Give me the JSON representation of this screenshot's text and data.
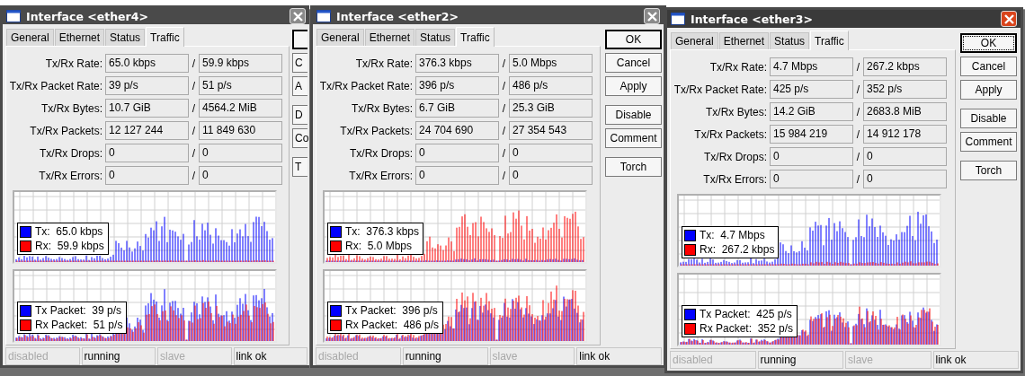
{
  "windows": [
    {
      "title": "Interface <ether4>",
      "active": false,
      "tabs": [
        {
          "label": "General",
          "selected": false
        },
        {
          "label": "Ethernet",
          "selected": false
        },
        {
          "label": "Status",
          "selected": false
        },
        {
          "label": "Traffic",
          "selected": true
        }
      ],
      "fields": [
        {
          "label": "Tx/Rx Rate:",
          "tx": "65.0 kbps",
          "separator": "/",
          "rx": "59.9 kbps"
        },
        {
          "label": "Tx/Rx Packet Rate:",
          "tx": "39 p/s",
          "separator": "/",
          "rx": "51 p/s"
        },
        {
          "label": "Tx/Rx Bytes:",
          "tx": "10.7 GiB",
          "separator": "/",
          "rx": "4564.2 MiB"
        },
        {
          "label": "Tx/Rx Packets:",
          "tx": "12 127 244",
          "separator": "/",
          "rx": "11 849 630"
        },
        {
          "label": "Tx/Rx Drops:",
          "tx": "0",
          "separator": "/",
          "rx": "0"
        },
        {
          "label": "Tx/Rx Errors:",
          "tx": "0",
          "separator": "/",
          "rx": "0"
        }
      ],
      "graphs": [
        {
          "legend": [
            {
              "label": "Tx:",
              "value": "65.0 kbps",
              "color": "#0000ff"
            },
            {
              "label": "Rx:",
              "value": "59.9 kbps",
              "color": "#ff0000"
            }
          ]
        },
        {
          "legend": [
            {
              "label": "Tx Packet:",
              "value": "39 p/s",
              "color": "#0000ff"
            },
            {
              "label": "Rx Packet:",
              "value": "51 p/s",
              "color": "#ff0000"
            }
          ]
        }
      ],
      "buttons": [
        {
          "default": true,
          "focused": false
        },
        {
          "label": "C",
          "default": false,
          "focused": false
        },
        {
          "label": "A",
          "default": false,
          "focused": false
        },
        {
          "label": "D",
          "default": false,
          "focused": false
        },
        {
          "label": "Co",
          "default": false,
          "focused": false
        },
        {
          "label": "T",
          "default": false,
          "focused": false
        }
      ],
      "status": [
        {
          "text": "disabled",
          "active": false
        },
        {
          "text": "running",
          "active": true
        },
        {
          "text": "slave",
          "active": false
        },
        {
          "text": "link ok",
          "active": true
        }
      ]
    },
    {
      "title": "Interface <ether2>",
      "active": false,
      "tabs": [
        {
          "label": "General",
          "selected": false
        },
        {
          "label": "Ethernet",
          "selected": false
        },
        {
          "label": "Status",
          "selected": false
        },
        {
          "label": "Traffic",
          "selected": true
        }
      ],
      "fields": [
        {
          "label": "Tx/Rx Rate:",
          "tx": "376.3 kbps",
          "separator": "/",
          "rx": "5.0 Mbps"
        },
        {
          "label": "Tx/Rx Packet Rate:",
          "tx": "396 p/s",
          "separator": "/",
          "rx": "486 p/s"
        },
        {
          "label": "Tx/Rx Bytes:",
          "tx": "6.7 GiB",
          "separator": "/",
          "rx": "25.3 GiB"
        },
        {
          "label": "Tx/Rx Packets:",
          "tx": "24 704 690",
          "separator": "/",
          "rx": "27 354 543"
        },
        {
          "label": "Tx/Rx Drops:",
          "tx": "0",
          "separator": "/",
          "rx": "0"
        },
        {
          "label": "Tx/Rx Errors:",
          "tx": "0",
          "separator": "/",
          "rx": "0"
        }
      ],
      "graphs": [
        {
          "legend": [
            {
              "label": "Tx:",
              "value": "376.3 kbps",
              "color": "#0000ff"
            },
            {
              "label": "Rx:",
              "value": "5.0 Mbps",
              "color": "#ff0000"
            }
          ]
        },
        {
          "legend": [
            {
              "label": "Tx Packet:",
              "value": "396 p/s",
              "color": "#0000ff"
            },
            {
              "label": "Rx Packet:",
              "value": "486 p/s",
              "color": "#ff0000"
            }
          ]
        }
      ],
      "buttons": [
        {
          "label": "OK",
          "default": true,
          "focused": false
        },
        {
          "label": "Cancel",
          "default": false,
          "focused": false
        },
        {
          "label": "Apply",
          "default": false,
          "focused": false
        },
        {
          "label": "Disable",
          "default": false,
          "focused": false
        },
        {
          "label": "Comment",
          "default": false,
          "focused": false
        },
        {
          "label": "Torch",
          "default": false,
          "focused": false
        }
      ],
      "status": [
        {
          "text": "disabled",
          "active": false
        },
        {
          "text": "running",
          "active": true
        },
        {
          "text": "slave",
          "active": false
        },
        {
          "text": "link ok",
          "active": true
        }
      ]
    },
    {
      "title": "Interface <ether3>",
      "active": true,
      "tabs": [
        {
          "label": "General",
          "selected": false
        },
        {
          "label": "Ethernet",
          "selected": false
        },
        {
          "label": "Status",
          "selected": false
        },
        {
          "label": "Traffic",
          "selected": true
        }
      ],
      "fields": [
        {
          "label": "Tx/Rx Rate:",
          "tx": "4.7 Mbps",
          "separator": "/",
          "rx": "267.2 kbps"
        },
        {
          "label": "Tx/Rx Packet Rate:",
          "tx": "425 p/s",
          "separator": "/",
          "rx": "352 p/s"
        },
        {
          "label": "Tx/Rx Bytes:",
          "tx": "14.2 GiB",
          "separator": "/",
          "rx": "2683.8 MiB"
        },
        {
          "label": "Tx/Rx Packets:",
          "tx": "15 984 219",
          "separator": "/",
          "rx": "14 912 178"
        },
        {
          "label": "Tx/Rx Drops:",
          "tx": "0",
          "separator": "/",
          "rx": "0"
        },
        {
          "label": "Tx/Rx Errors:",
          "tx": "0",
          "separator": "/",
          "rx": "0"
        }
      ],
      "graphs": [
        {
          "legend": [
            {
              "label": "Tx:",
              "value": "4.7 Mbps",
              "color": "#0000ff"
            },
            {
              "label": "Rx:",
              "value": "267.2 kbps",
              "color": "#ff0000"
            }
          ]
        },
        {
          "legend": [
            {
              "label": "Tx Packet:",
              "value": "425 p/s",
              "color": "#0000ff"
            },
            {
              "label": "Rx Packet:",
              "value": "352 p/s",
              "color": "#ff0000"
            }
          ]
        }
      ],
      "buttons": [
        {
          "label": "OK",
          "default": true,
          "focused": true
        },
        {
          "label": "Cancel",
          "default": false,
          "focused": false
        },
        {
          "label": "Apply",
          "default": false,
          "focused": false
        },
        {
          "label": "Disable",
          "default": false,
          "focused": false
        },
        {
          "label": "Comment",
          "default": false,
          "focused": false
        },
        {
          "label": "Torch",
          "default": false,
          "focused": false
        }
      ],
      "status": [
        {
          "text": "disabled",
          "active": false
        },
        {
          "text": "running",
          "active": true
        },
        {
          "text": "slave",
          "active": false
        },
        {
          "text": "link ok",
          "active": true
        }
      ]
    }
  ]
}
